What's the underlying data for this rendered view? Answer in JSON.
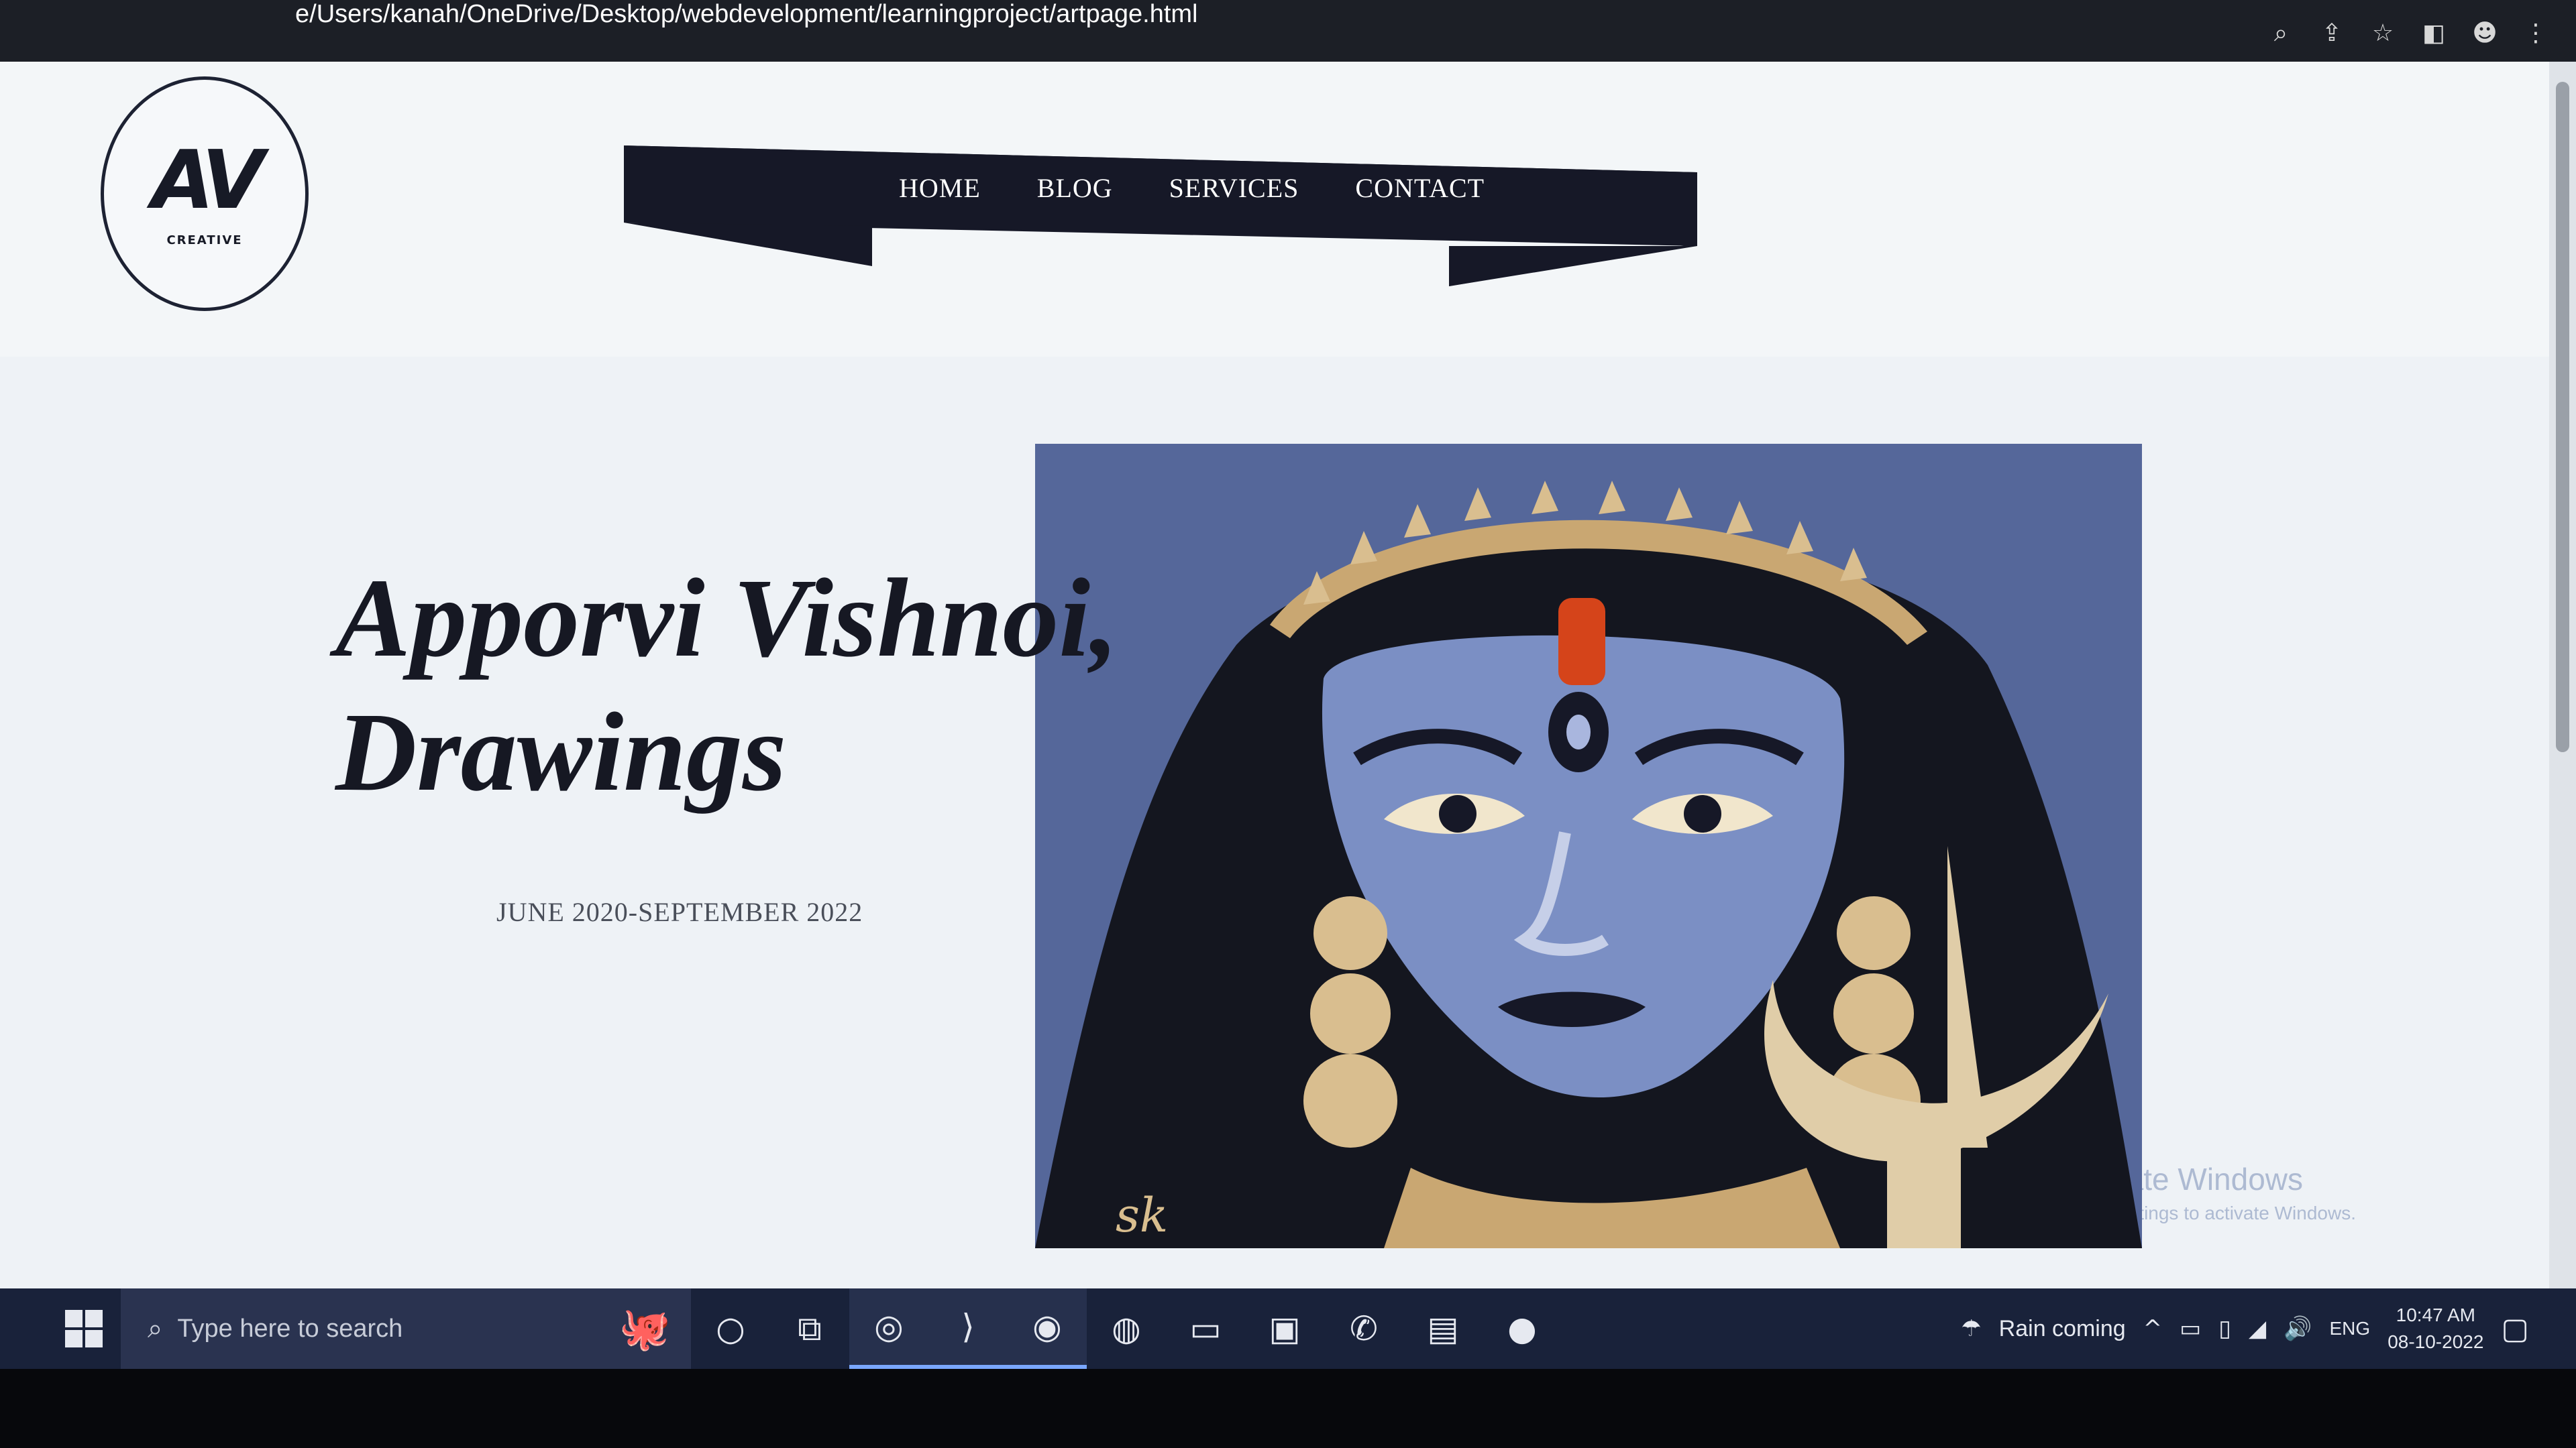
{
  "browser": {
    "url": "e/Users/kanah/OneDrive/Desktop/webdevelopment/learningproject/artpage.html",
    "icons": [
      "zoom-icon",
      "share-icon",
      "star-icon",
      "sidebar-icon",
      "profile-icon",
      "menu-icon"
    ]
  },
  "site": {
    "logo": {
      "mark": "AV",
      "tagline": "CREATIVE"
    },
    "nav": [
      {
        "label": "HOME"
      },
      {
        "label": "BLOG"
      },
      {
        "label": "SERVICES"
      },
      {
        "label": "CONTACT"
      }
    ],
    "hero": {
      "title_line1": "Apporvi Vishnoi,",
      "title_line2": "Drawings",
      "date_range": "JUNE 2020-SEPTEMBER 2022"
    },
    "watermark": {
      "title": "Activate Windows",
      "subtitle": "Go to Settings to activate Windows."
    }
  },
  "taskbar": {
    "search_placeholder": "Type here to search",
    "apps": [
      "search-app-icon",
      "task-view-icon",
      "edge-icon",
      "vscode-icon",
      "edge-beta-icon",
      "chrome-icon",
      "file-explorer-icon",
      "store-icon",
      "whatsapp-icon",
      "photos-icon",
      "grammarly-icon"
    ],
    "weather": "Rain coming",
    "language": "ENG",
    "time": "10:47 AM",
    "date": "08-10-2022"
  },
  "colors": {
    "nav_bg": "#161827",
    "title_text": "#161823",
    "taskbar_bg": "#19223a"
  }
}
